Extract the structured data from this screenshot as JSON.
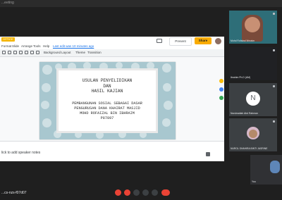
{
  "top": {
    "title": "...eeting"
  },
  "docs": {
    "badge": "OFFICE",
    "menu": [
      "Format",
      "Slide",
      "Arrange",
      "Tools",
      "Help"
    ],
    "last_edit": "Last edit was 10 minutes ago",
    "present_label": "Present",
    "share_label": "Share",
    "toolbar": {
      "background": "Background",
      "layout": "Layout",
      "theme": "Theme",
      "transition": "Transition"
    },
    "notes_placeholder": "lick to add speaker notes"
  },
  "slide": {
    "title_line1": "USULAN PENYELIDIKAN",
    "title_line2": "DAN",
    "title_line3": "HASIL KAJIAN",
    "sub1": "PEMBANGUNAN SOSIAL SEBAGAI DASAR",
    "sub2": "PENGURUSAN DANA KHAIRAT MASJID",
    "sub3": "MOHD ROFAIZAL BIN IBHRAIM",
    "sub4": "P87897"
  },
  "participants": [
    {
      "name": "Mohd Rofaizal Ibhraim",
      "avatar": "photo"
    },
    {
      "name": "Ibrahim Ph.D (AM)",
      "avatar": "dark"
    },
    {
      "name": "",
      "avatar": "dark"
    },
    {
      "name": "Nurulnadiah Abd Rahman",
      "avatar": "N"
    },
    {
      "name": "NUROL SHAHIRA BINTI JASRINE",
      "avatar": "photo-hijab"
    },
    {
      "name": "You",
      "avatar": "photo-small"
    }
  ],
  "bottom": {
    "meeting_code": "...cs-nzs-f07d07"
  },
  "colors": {
    "share": "#f9ab00",
    "end_call": "#ea4335",
    "accent": "#1a73e8"
  }
}
